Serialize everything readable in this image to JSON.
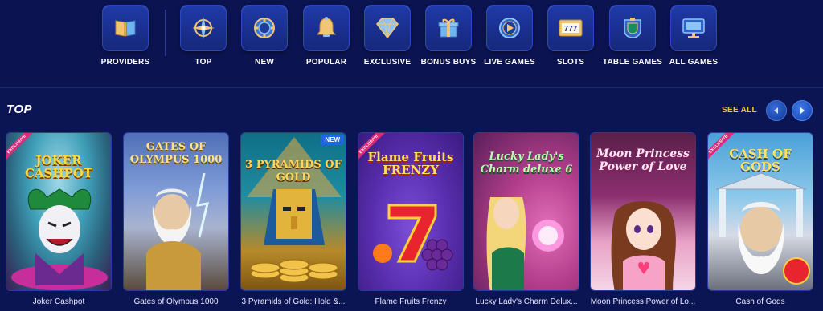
{
  "categories": [
    {
      "label": "PROVIDERS",
      "icon": "book-icon"
    },
    {
      "label": "TOP",
      "icon": "compass-icon"
    },
    {
      "label": "NEW",
      "icon": "chip-icon"
    },
    {
      "label": "POPULAR",
      "icon": "bell-icon"
    },
    {
      "label": "EXCLUSIVE",
      "icon": "diamond-icon"
    },
    {
      "label": "BONUS BUYS",
      "icon": "gift-icon"
    },
    {
      "label": "LIVE GAMES",
      "icon": "play-icon"
    },
    {
      "label": "SLOTS",
      "icon": "slot-777-icon"
    },
    {
      "label": "TABLE GAMES",
      "icon": "table-icon"
    },
    {
      "label": "ALL GAMES",
      "icon": "monitor-icon"
    }
  ],
  "section": {
    "title": "TOP",
    "see_all": "SEE ALL"
  },
  "games": [
    {
      "name": "Joker Cashpot",
      "art_title": "JOKER CASHPOT",
      "badge": "EXCLUSIVE"
    },
    {
      "name": "Gates of Olympus 1000",
      "art_title": "GATES OF OLYMPUS 1000",
      "badge": ""
    },
    {
      "name": "3 Pyramids of Gold: Hold &...",
      "art_title": "3 PYRAMIDS OF GOLD",
      "badge": "NEW"
    },
    {
      "name": "Flame Fruits Frenzy",
      "art_title": "Flame Fruits FRENZY",
      "badge": "EXCLUSIVE"
    },
    {
      "name": "Lucky Lady's Charm Delux...",
      "art_title": "Lucky Lady's Charm deluxe 6",
      "badge": ""
    },
    {
      "name": "Moon Princess Power of Lo...",
      "art_title": "Moon Princess Power of Love",
      "badge": ""
    },
    {
      "name": "Cash of Gods",
      "art_title": "CASH OF GODS",
      "badge": "EXCLUSIVE"
    }
  ],
  "colors": {
    "background": "#0c1553",
    "accent_gold": "#f5c542",
    "tile_blue": "#1f3aa8",
    "badge_new": "#1f67e0",
    "badge_exclusive": "#d92c7b"
  }
}
